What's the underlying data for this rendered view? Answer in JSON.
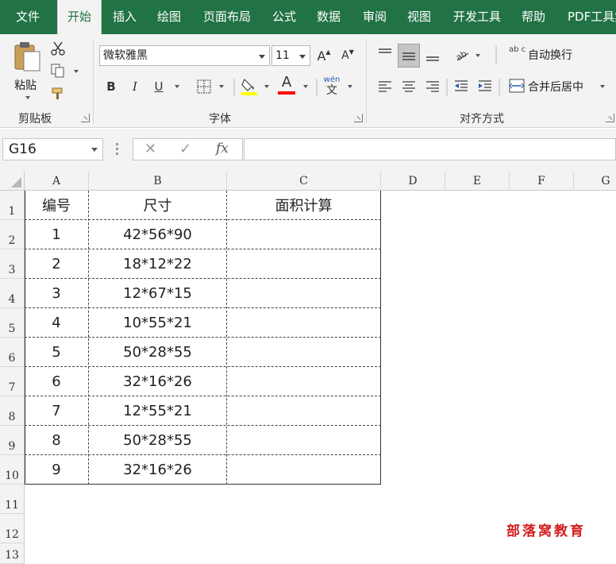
{
  "menu": {
    "tabs": [
      "文件",
      "开始",
      "插入",
      "绘图",
      "页面布局",
      "公式",
      "数据",
      "审阅",
      "视图",
      "开发工具",
      "帮助",
      "PDF工具集"
    ],
    "active": "开始"
  },
  "ribbon": {
    "clipboard": {
      "paste_label": "粘贴",
      "group_label": "剪贴板"
    },
    "font": {
      "font_name": "微软雅黑",
      "font_size": "11",
      "bold": "B",
      "italic": "I",
      "underline": "U",
      "font_color_glyph": "A",
      "phonetic_top": "wén",
      "phonetic_bottom": "文",
      "grow": "A",
      "shrink": "A",
      "group_label": "字体",
      "fill_color": "#ffff00",
      "font_color": "#ff0000"
    },
    "alignment": {
      "wrap_text": "自动换行",
      "merge_center": "合并后居中",
      "wrap_glyph": "ab c",
      "group_label": "对齐方式"
    }
  },
  "formula_bar": {
    "name_box": "G16",
    "fx": "fx",
    "formula": ""
  },
  "columns": [
    "A",
    "B",
    "C",
    "D",
    "E",
    "F",
    "G"
  ],
  "rows": [
    "1",
    "2",
    "3",
    "4",
    "5",
    "6",
    "7",
    "8",
    "9",
    "10",
    "11",
    "12",
    "13"
  ],
  "table": {
    "headers": [
      "编号",
      "尺寸",
      "面积计算"
    ],
    "rows": [
      [
        "1",
        "42*56*90",
        ""
      ],
      [
        "2",
        "18*12*22",
        ""
      ],
      [
        "3",
        "12*67*15",
        ""
      ],
      [
        "4",
        "10*55*21",
        ""
      ],
      [
        "5",
        "50*28*55",
        ""
      ],
      [
        "6",
        "32*16*26",
        ""
      ],
      [
        "7",
        "12*55*21",
        ""
      ],
      [
        "8",
        "50*28*55",
        ""
      ],
      [
        "9",
        "32*16*26",
        ""
      ]
    ]
  },
  "watermark": "部落窝教育",
  "colors": {
    "brand": "#217346",
    "ribbon_bg": "#f3f3f3",
    "watermark": "#d42020"
  }
}
